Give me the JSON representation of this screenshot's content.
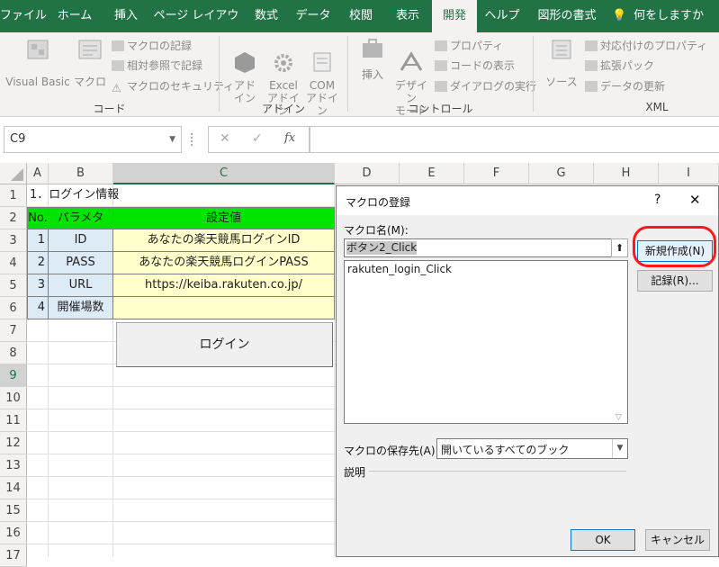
{
  "ribbon_tabs": [
    "ファイル",
    "ホーム",
    "挿入",
    "ページ レイアウト",
    "数式",
    "データ",
    "校閲",
    "表示",
    "開発",
    "ヘルプ",
    "図形の書式",
    "何をしますか"
  ],
  "ribbon": {
    "code": {
      "visual_basic": "Visual Basic",
      "macro": "マクロ",
      "record_macro": "マクロの記録",
      "relative_ref": "相対参照で記録",
      "macro_security": "マクロのセキュリティ",
      "group_label": "コード"
    },
    "addins": {
      "addin": "アド\nイン",
      "excel_addin": "Excel\nアドイン",
      "com_addin": "COM\nアドイン",
      "group_label": "アドイン"
    },
    "controls": {
      "insert": "挿入",
      "design_mode": "デザイン\nモード",
      "properties": "プロパティ",
      "view_code": "コードの表示",
      "run_dialog": "ダイアログの実行",
      "group_label": "コントロール"
    },
    "xml": {
      "source": "ソース",
      "map_properties": "対応付けのプロパティ",
      "expansion_packs": "拡張パック",
      "refresh_data": "データの更新",
      "group_label": "XML"
    }
  },
  "formula_bar": {
    "name_box": "C9",
    "cancel": "✕",
    "enter": "✓",
    "fx": "fx",
    "value": ""
  },
  "columns": [
    "A",
    "B",
    "C",
    "D",
    "E",
    "F",
    "G",
    "H",
    "I"
  ],
  "rows": [
    "1",
    "2",
    "3",
    "4",
    "5",
    "6",
    "7",
    "8",
    "9",
    "10",
    "11",
    "12",
    "13",
    "14",
    "15",
    "16",
    "17"
  ],
  "sheet": {
    "title": "1．ログイン情報",
    "headers": {
      "no": "No.",
      "param": "パラメタ",
      "value": "設定値"
    },
    "table": [
      {
        "no": "1",
        "param": "ID",
        "value": "あなたの楽天競馬ログインID"
      },
      {
        "no": "2",
        "param": "PASS",
        "value": "あなたの楽天競馬ログインPASS"
      },
      {
        "no": "3",
        "param": "URL",
        "value": "https://keiba.rakuten.co.jp/"
      },
      {
        "no": "4",
        "param": "開催場数",
        "value": ""
      }
    ],
    "login_button": "ログイン"
  },
  "dialog": {
    "title": "マクロの登録",
    "help": "?",
    "close": "✕",
    "macro_name_label": "マクロ名(M):",
    "macro_name_value": "ボタン2_Click",
    "macro_list": [
      "rakuten_login_Click"
    ],
    "new_button": "新規作成(N)",
    "record_button": "記録(R)...",
    "save_in_label": "マクロの保存先(A):",
    "save_in_value": "開いているすべてのブック",
    "description_label": "説明",
    "ok": "OK",
    "cancel": "キャンセル"
  },
  "colors": {
    "accent": "#217346",
    "highlight": "#ff1a1a",
    "header_green": "#00e400",
    "value_yellow": "#ffffcc",
    "no_blue": "#ddebf7"
  }
}
